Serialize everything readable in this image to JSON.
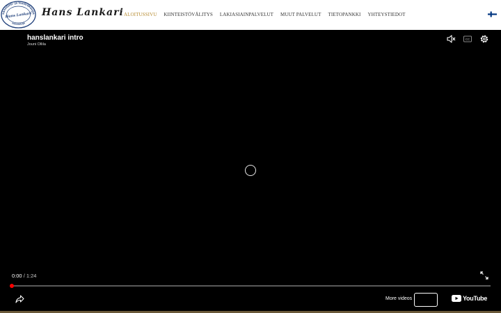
{
  "header": {
    "logo_seal": {
      "top_text": "Isännöinti- ja Vuokrakaupat",
      "center_text": "Hans Lankari",
      "bottom_text": "Isännöitsijä"
    },
    "logo_text": "Hans Lankari",
    "nav": [
      {
        "label": "Aloitussivu",
        "active": true
      },
      {
        "label": "Kiinteistövälitys",
        "active": false
      },
      {
        "label": "Lakiasiainpalvelut",
        "active": false
      },
      {
        "label": "Muut palvelut",
        "active": false
      },
      {
        "label": "Tietopankki",
        "active": false
      },
      {
        "label": "Yhteystiedot",
        "active": false
      }
    ],
    "language_flag": "finland-flag-icon"
  },
  "player": {
    "title": "hanslankari intro",
    "channel": "Jouni Ollila",
    "current_time": "0:00",
    "separator": " / ",
    "duration": "1:24",
    "progress_fraction": 0.0,
    "more_videos_label": "More videos",
    "youtube_label": "YouTube",
    "icons": [
      "mute-icon",
      "captions-icon",
      "settings-icon",
      "loading-spinner-icon",
      "fullscreen-icon",
      "share-icon",
      "youtube-logo-icon"
    ]
  },
  "colors": {
    "accent_nav_active": "#b58a2e",
    "progress": "#ff0000",
    "youtube_red": "#ff0000"
  }
}
